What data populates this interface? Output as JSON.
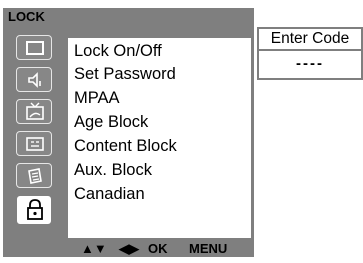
{
  "menu": {
    "title": "LOCK",
    "items": [
      {
        "label": "Lock On/Off"
      },
      {
        "label": "Set Password"
      },
      {
        "label": "MPAA"
      },
      {
        "label": "Age Block"
      },
      {
        "label": "Content Block"
      },
      {
        "label": "Aux. Block"
      },
      {
        "label": "Canadian"
      }
    ],
    "sidebar_icons": [
      "screen-icon",
      "speaker-icon",
      "tv-icon",
      "time-icon",
      "options-icon",
      "lock-icon"
    ],
    "active_sidebar_icon": "lock-icon"
  },
  "footer": {
    "nav_updown": "▲▼",
    "nav_leftright": "◀▶",
    "ok": "OK",
    "menu": "MENU"
  },
  "code_entry": {
    "title": "Enter Code",
    "value": "----"
  },
  "colors": {
    "panel": "#7f7f7f",
    "background": "#ffffff",
    "text": "#000000"
  }
}
